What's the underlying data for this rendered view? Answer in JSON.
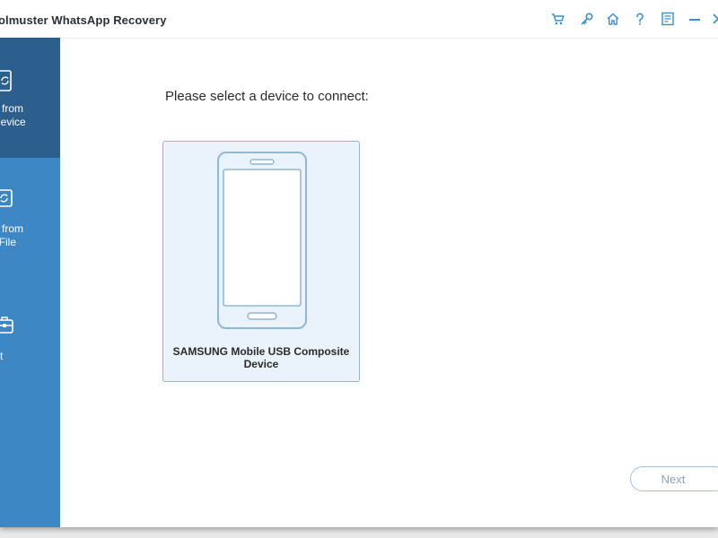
{
  "window": {
    "title": "olmuster WhatsApp Recovery"
  },
  "toolbar": {
    "icons": [
      "cart-icon",
      "key-icon",
      "home-icon",
      "help-icon",
      "feedback-icon",
      "minimize-icon",
      "close-icon"
    ]
  },
  "sidebar": {
    "items": [
      {
        "label_line1": "ver from",
        "label_line2": "d Device",
        "icon": "device-recover-icon",
        "active": true
      },
      {
        "label_line1": "ver from",
        "label_line2": "up File",
        "icon": "backup-recover-icon",
        "active": false
      },
      {
        "label_line1": "olkit",
        "icon": "toolkit-icon",
        "active": false
      }
    ]
  },
  "main": {
    "prompt": "Please select a device to connect:",
    "device": {
      "name_line1": "SAMSUNG Mobile USB Composite",
      "name_line2": "Device"
    },
    "next_label": "Next"
  },
  "colors": {
    "sidebar": "#3e87c5",
    "sidebar_active": "#2d5f8e",
    "accent": "#3a8fd0",
    "card_bg": "#eaf3fb"
  }
}
